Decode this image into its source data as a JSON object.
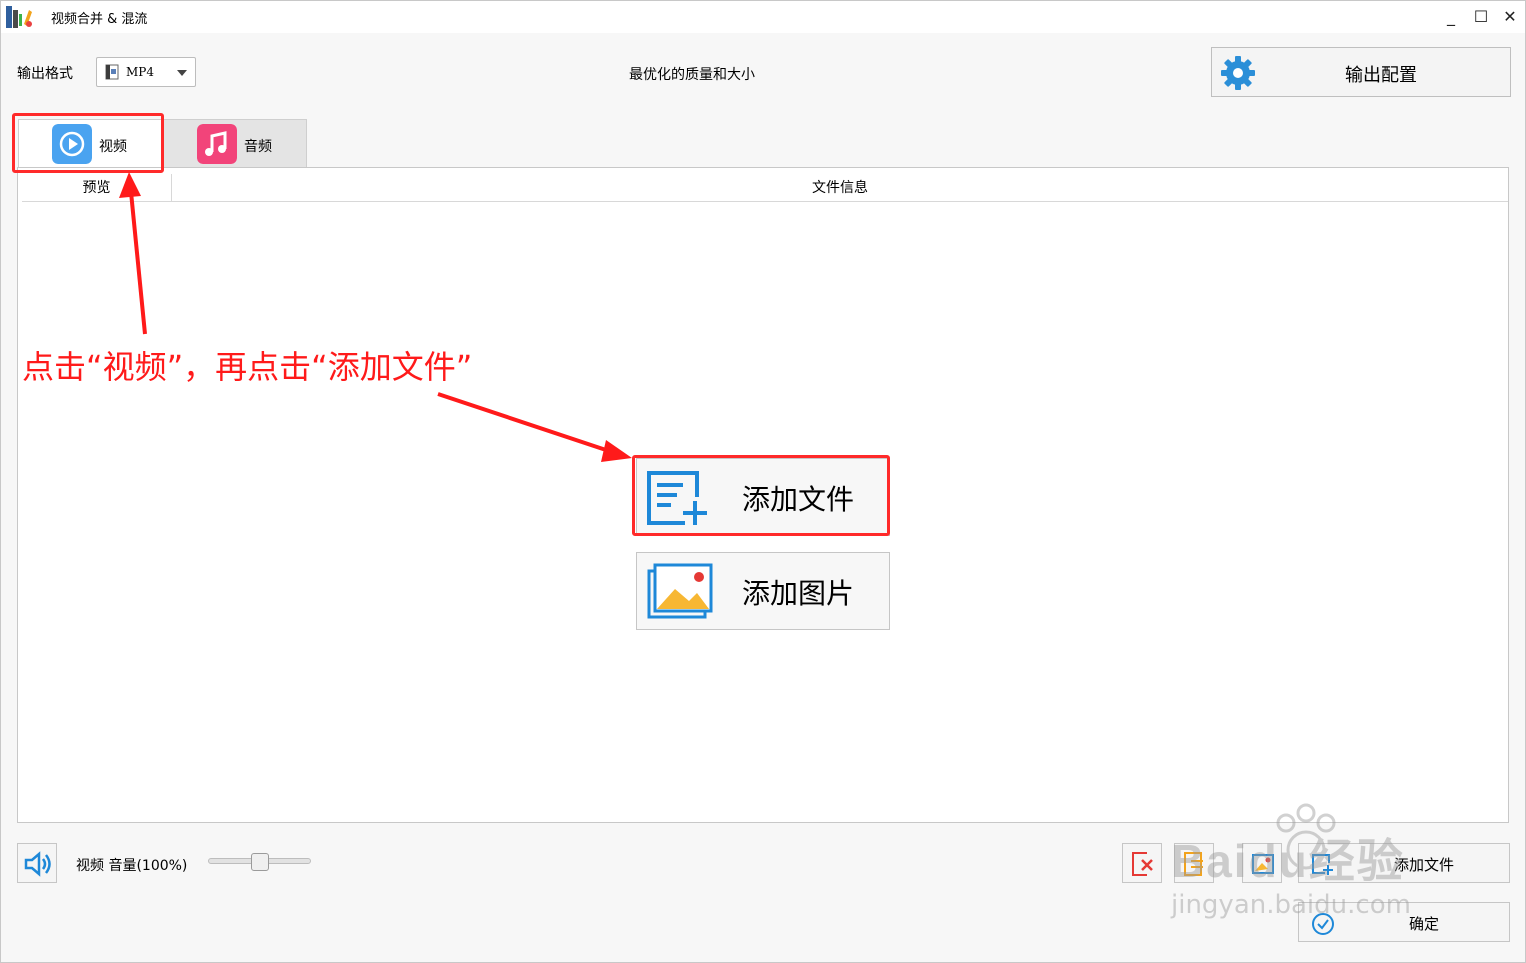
{
  "window": {
    "title": "视频合并 & 混流",
    "minimize_label": "_",
    "maximize_label": "☐",
    "close_label": "✕"
  },
  "toolbar": {
    "output_format_label": "输出格式",
    "output_format_value": "MP4",
    "quality_text": "最优化的质量和大小",
    "config_button_label": "输出配置"
  },
  "tabs": [
    {
      "label": "视频",
      "icon": "play-icon",
      "selected": true,
      "color": "#4aa3f0"
    },
    {
      "label": "音频",
      "icon": "music-note-icon",
      "selected": false,
      "color": "#f2447a"
    }
  ],
  "columns": {
    "preview": "预览",
    "file_info": "文件信息"
  },
  "main": {
    "add_file_label": "添加文件",
    "add_image_label": "添加图片"
  },
  "bottom": {
    "volume_label": "视频 音量(100%)",
    "volume_value": 1.0,
    "add_file_label": "添加文件",
    "confirm_label": "确定"
  },
  "annotation": {
    "text": "点击“视频”，再点击“添加文件”",
    "color": "#ff1a1a"
  },
  "watermark": {
    "brand": "Baidu经验",
    "url": "jingyan.baidu.com"
  }
}
